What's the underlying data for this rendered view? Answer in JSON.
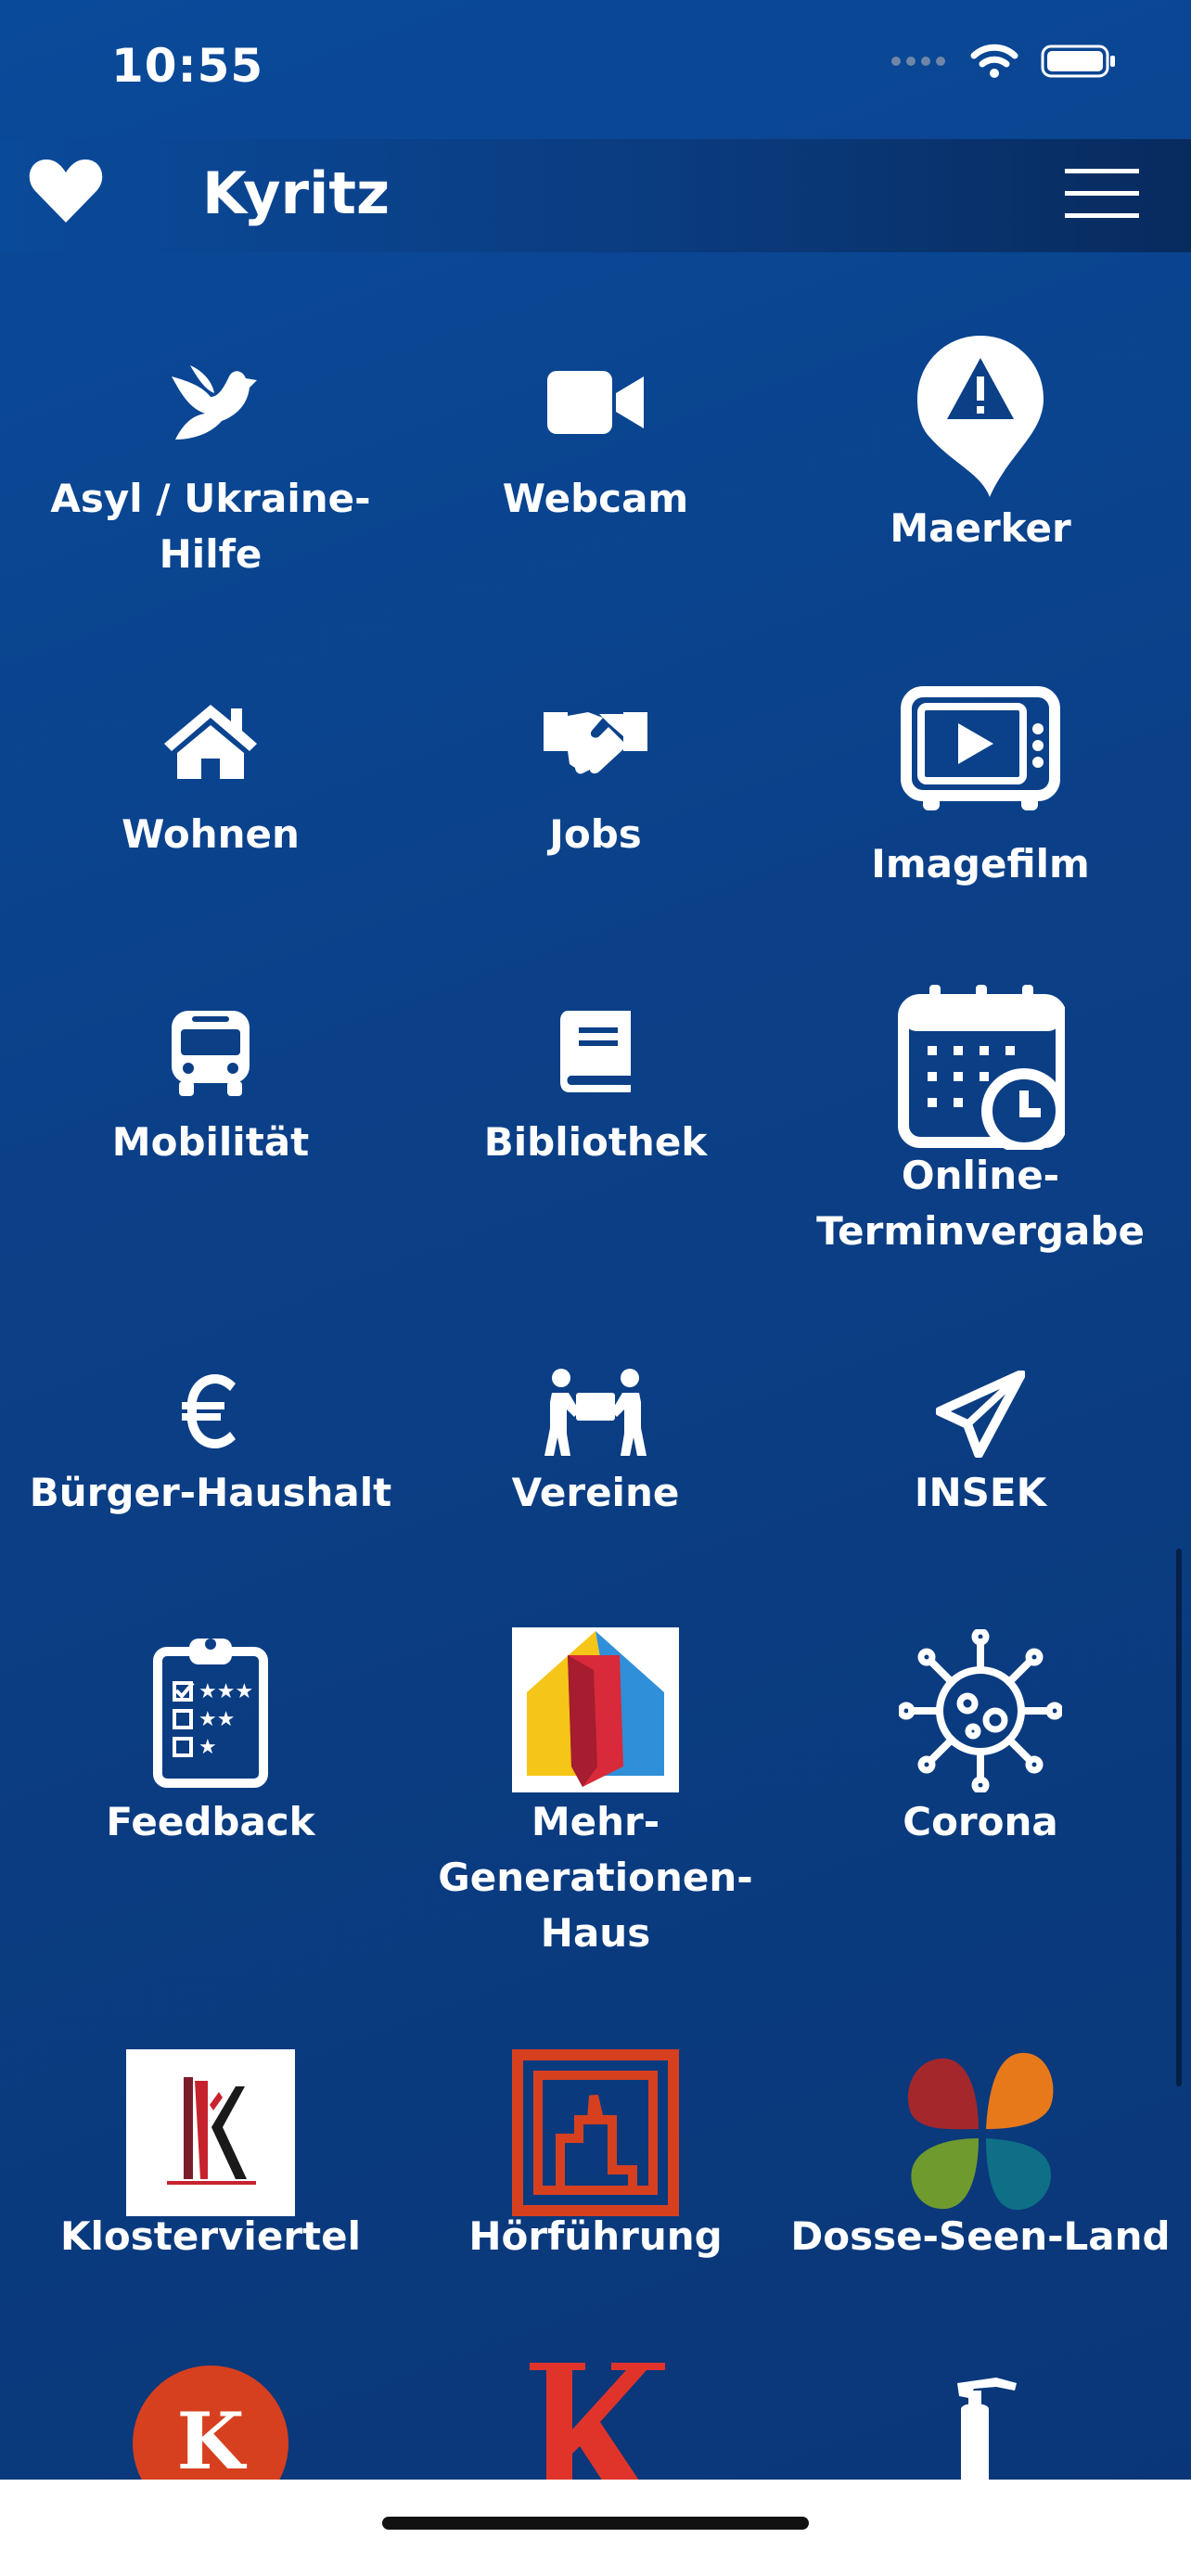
{
  "status": {
    "time": "10:55"
  },
  "header": {
    "title": "Kyritz"
  },
  "tiles": [
    {
      "label": "Asyl / Ukraine-\nHilfe",
      "icon": "dove-icon"
    },
    {
      "label": "Webcam",
      "icon": "video-camera-icon"
    },
    {
      "label": "Maerker",
      "icon": "alert-pin-icon"
    },
    {
      "label": "Wohnen",
      "icon": "home-icon"
    },
    {
      "label": "Jobs",
      "icon": "handshake-icon"
    },
    {
      "label": "Imagefilm",
      "icon": "tv-play-icon"
    },
    {
      "label": "Mobilität",
      "icon": "bus-icon"
    },
    {
      "label": "Bibliothek",
      "icon": "book-icon"
    },
    {
      "label": "Online-\nTerminvergabe",
      "icon": "calendar-clock-icon"
    },
    {
      "label": "Bürger-Haushalt",
      "icon": "euro-icon"
    },
    {
      "label": "Vereine",
      "icon": "people-carry-icon"
    },
    {
      "label": "INSEK",
      "icon": "paper-plane-icon"
    },
    {
      "label": "Feedback",
      "icon": "clipboard-rating-icon"
    },
    {
      "label": "Mehr-\nGenerationen-\nHaus",
      "icon": "puzzle-house-logo"
    },
    {
      "label": "Corona",
      "icon": "virus-icon"
    },
    {
      "label": "Klosterviertel",
      "icon": "klosterviertel-logo"
    },
    {
      "label": "Hörführung",
      "icon": "hoerfuehrung-logo"
    },
    {
      "label": "Dosse-Seen-Land",
      "icon": "clover-logo"
    },
    {
      "label": "",
      "icon": "k-circle-logo"
    },
    {
      "label": "",
      "icon": "k-red-logo"
    },
    {
      "label": "",
      "icon": "fire-extinguisher-icon"
    }
  ],
  "colors": {
    "background": "#0b3f86",
    "text": "#ffffff",
    "accent_red": "#d6401f"
  }
}
